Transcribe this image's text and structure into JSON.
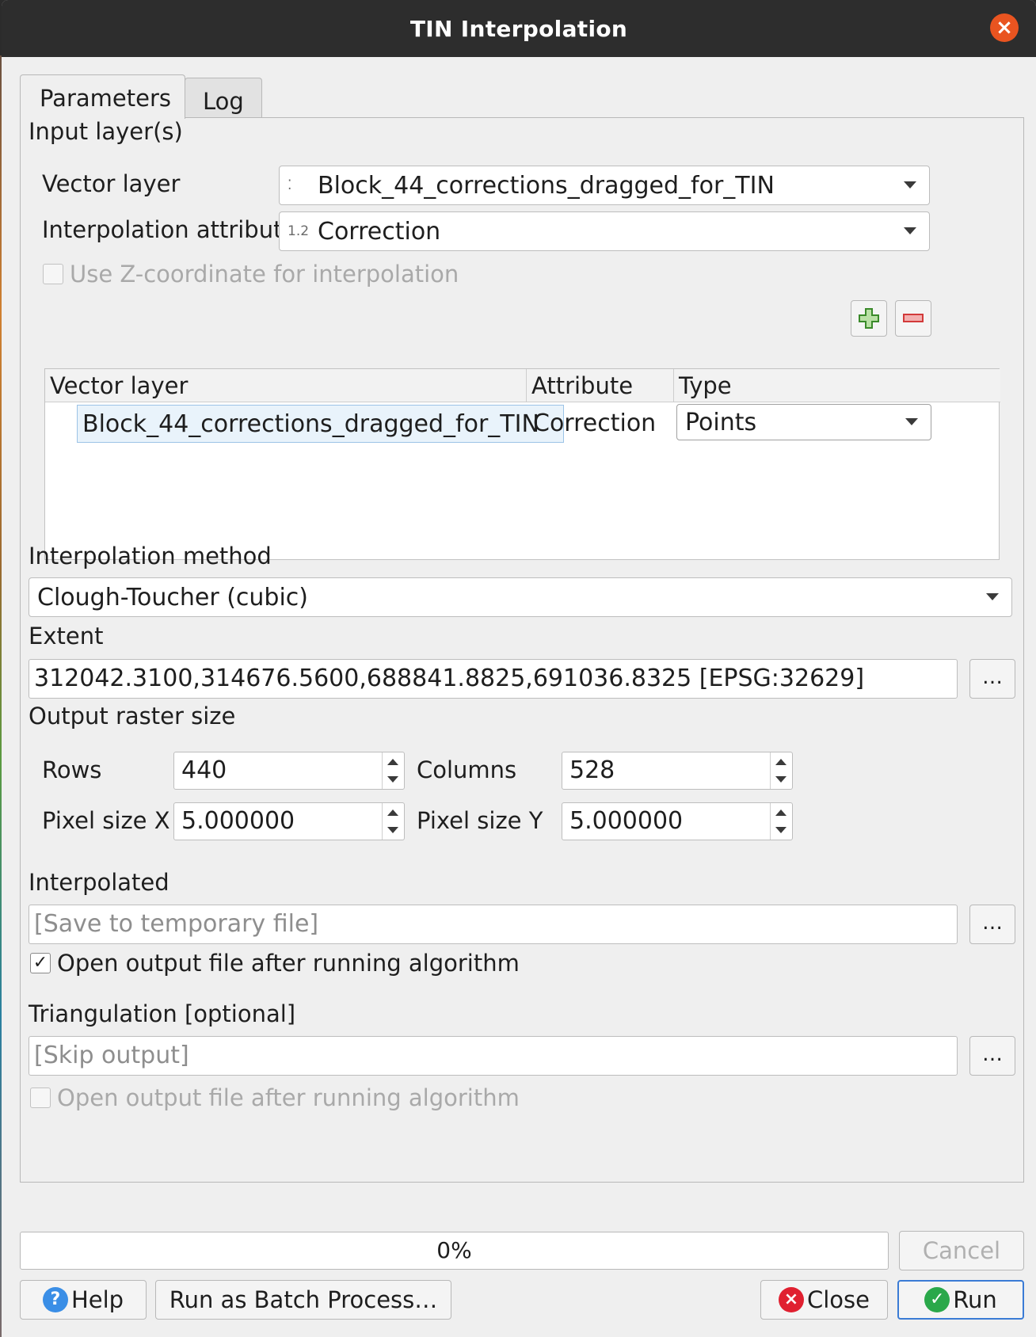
{
  "window": {
    "title": "TIN Interpolation"
  },
  "tabs": [
    {
      "label": "Parameters"
    },
    {
      "label": "Log"
    }
  ],
  "input_section": {
    "heading": "Input layer(s)",
    "vector_layer_label": "Vector layer",
    "vector_layer_value": "Block_44_corrections_dragged_for_TIN",
    "vector_layer_icon_text": "⁚",
    "interp_attr_label": "Interpolation attribute",
    "interp_attr_value": "Correction",
    "interp_attr_icon_text": "1.2",
    "use_z_label": "Use Z-coordinate for interpolation",
    "use_z_checked": false
  },
  "layer_table": {
    "headers": [
      "Vector layer",
      "Attribute",
      "Type"
    ],
    "rows": [
      {
        "layer": "Block_44_corrections_dragged_for_TIN",
        "attribute": "Correction",
        "type": "Points"
      }
    ]
  },
  "method": {
    "label": "Interpolation method",
    "value": "Clough-Toucher (cubic)"
  },
  "extent": {
    "label": "Extent",
    "value": "312042.3100,314676.5600,688841.8825,691036.8325 [EPSG:32629]"
  },
  "raster": {
    "label": "Output raster size",
    "rows_label": "Rows",
    "rows_value": "440",
    "columns_label": "Columns",
    "columns_value": "528",
    "pixel_x_label": "Pixel size X",
    "pixel_x_value": "5.000000",
    "pixel_y_label": "Pixel size Y",
    "pixel_y_value": "5.000000"
  },
  "interpolated": {
    "label": "Interpolated",
    "placeholder": "[Save to temporary file]",
    "open_label": "Open output file after running algorithm",
    "open_checked": true
  },
  "triangulation": {
    "label": "Triangulation [optional]",
    "placeholder": "[Skip output]",
    "open_label": "Open output file after running algorithm",
    "open_checked": false
  },
  "browse_label": "…",
  "progress": {
    "text": "0%",
    "value": 0
  },
  "buttons": {
    "cancel": "Cancel",
    "help": "Help",
    "batch": "Run as Batch Process…",
    "close": "Close",
    "run": "Run"
  },
  "colors": {
    "accent": "#e95420",
    "help": "#3a8ee6",
    "close": "#e02030",
    "run": "#2aa84a"
  }
}
